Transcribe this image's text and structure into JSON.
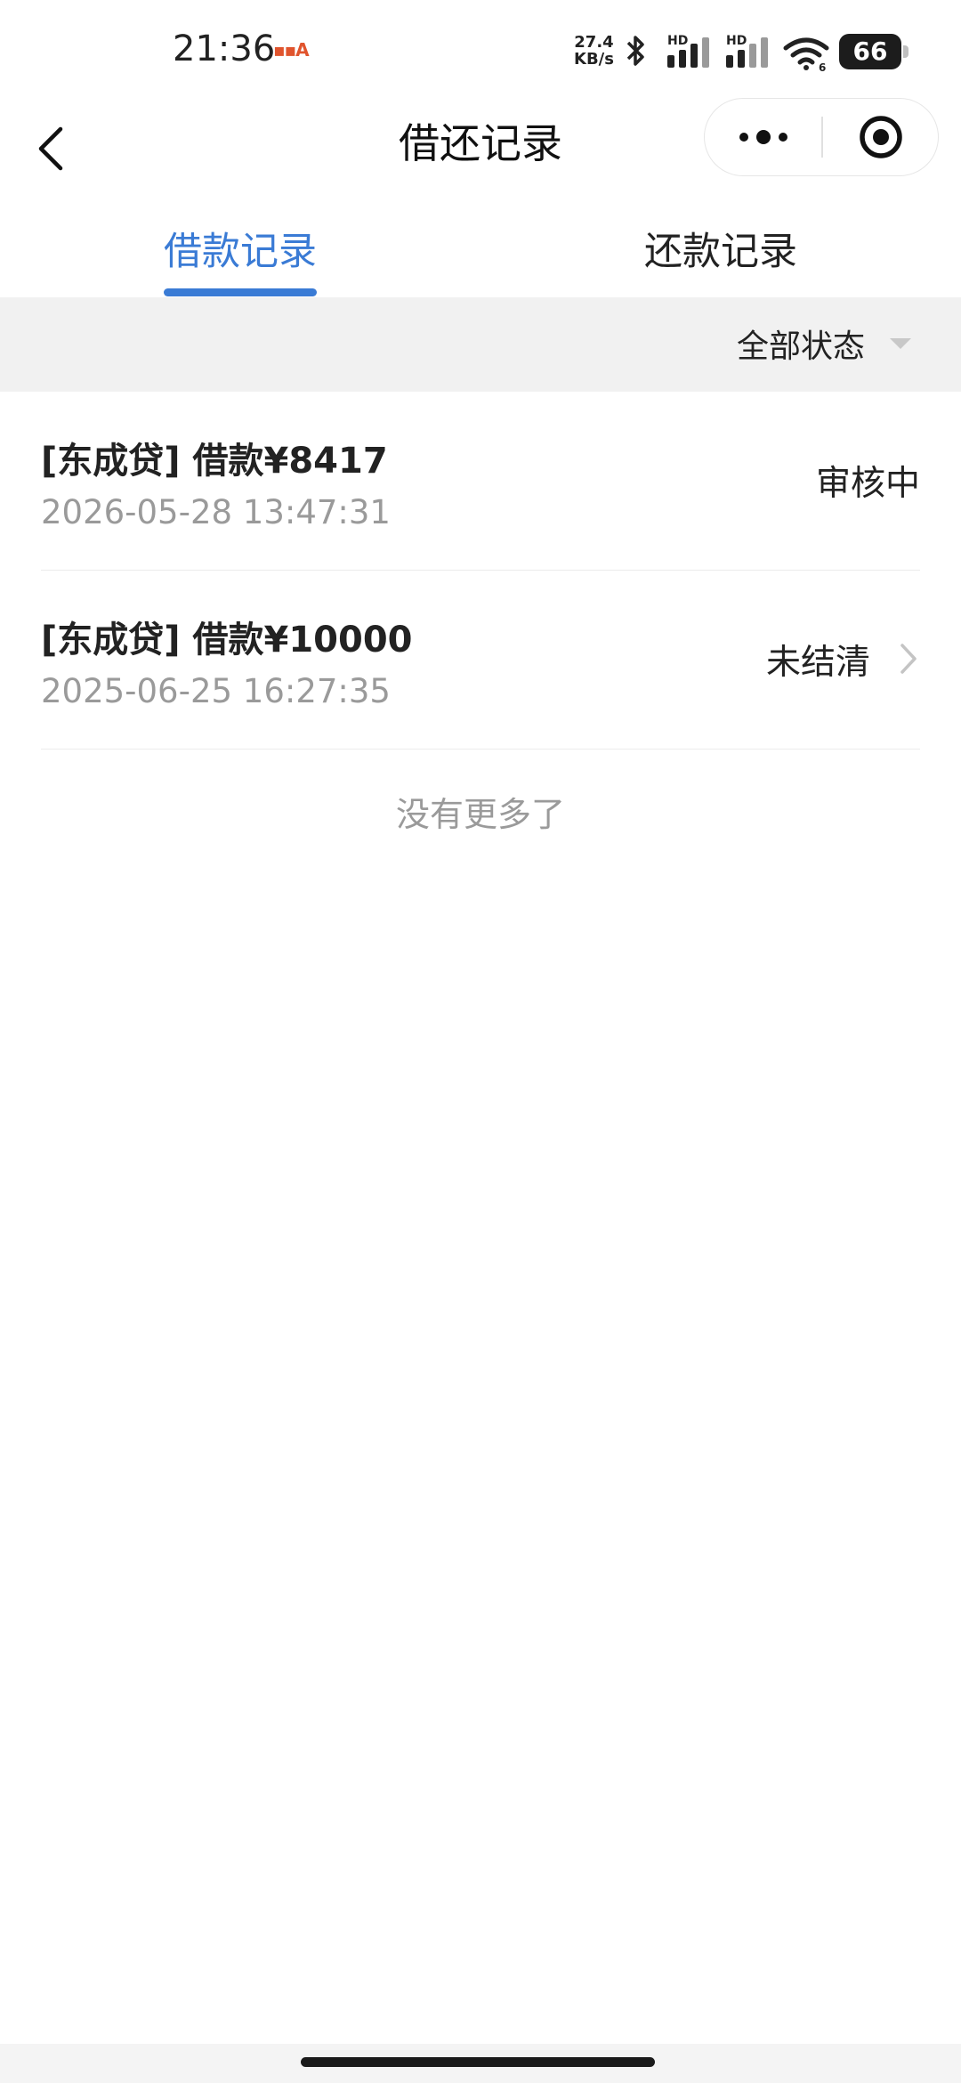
{
  "status_bar": {
    "time": "21:36",
    "app_icon_text": "A",
    "network_speed_value": "27.4",
    "network_speed_unit": "KB/s",
    "signal_label_1": "HD",
    "signal_label_2": "HD",
    "battery": "66",
    "icons": [
      "bluetooth-icon",
      "signal-icon",
      "signal-icon",
      "wifi-icon",
      "battery-icon"
    ]
  },
  "nav": {
    "title": "借还记录",
    "back_icon": "chevron-left-icon",
    "more_icon": "more-dots-icon",
    "close_icon": "target-circle-icon"
  },
  "tabs": [
    {
      "label": "借款记录",
      "active": true
    },
    {
      "label": "还款记录",
      "active": false
    }
  ],
  "filter": {
    "selected": "全部状态"
  },
  "records": [
    {
      "title": "[东成贷] 借款¥8417",
      "time": "2026-05-28 13:47:31",
      "status": "审核中",
      "has_arrow": false
    },
    {
      "title": "[东成贷] 借款¥10000",
      "time": "2025-06-25 16:27:35",
      "status": "未结清",
      "has_arrow": true
    }
  ],
  "end_text": "没有更多了",
  "colors": {
    "accent": "#3a7bd5",
    "filter_bg": "#f1f1f1",
    "secondary_text": "#9a9a9a"
  }
}
